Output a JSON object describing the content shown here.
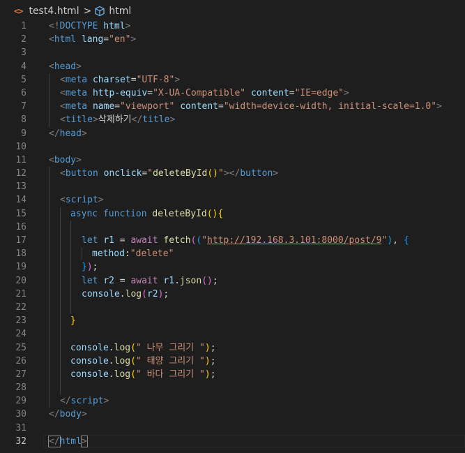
{
  "breadcrumb": {
    "file_icon": "<>",
    "file": "test4.html",
    "separator": ">",
    "symbol_icon": "cube-symbol-icon",
    "symbol": "html"
  },
  "editor": {
    "current_line": 32,
    "line_numbers": [
      "1",
      "2",
      "3",
      "4",
      "5",
      "6",
      "7",
      "8",
      "9",
      "10",
      "11",
      "12",
      "13",
      "14",
      "15",
      "16",
      "17",
      "18",
      "19",
      "20",
      "21",
      "22",
      "23",
      "24",
      "25",
      "26",
      "27",
      "28",
      "29",
      "30",
      "31",
      "32"
    ],
    "l1": [
      "<!",
      "DOCTYPE",
      " ",
      "html",
      ">"
    ],
    "l2": [
      "<",
      "html",
      " ",
      "lang",
      "=",
      "\"en\"",
      ">"
    ],
    "l4": [
      "<",
      "head",
      ">"
    ],
    "l5": [
      "<",
      "meta",
      " ",
      "charset",
      "=",
      "\"UTF-8\"",
      ">"
    ],
    "l6": [
      "<",
      "meta",
      " ",
      "http-equiv",
      "=",
      "\"X-UA-Compatible\"",
      " ",
      "content",
      "=",
      "\"IE=edge\"",
      ">"
    ],
    "l7": [
      "<",
      "meta",
      " ",
      "name",
      "=",
      "\"viewport\"",
      " ",
      "content",
      "=",
      "\"width=device-width, initial-scale=1.0\"",
      ">"
    ],
    "l8": [
      "<",
      "title",
      ">",
      "삭제하기",
      "</",
      "title",
      ">"
    ],
    "l9": [
      "</",
      "head",
      ">"
    ],
    "l11": [
      "<",
      "body",
      ">"
    ],
    "l12": [
      "<",
      "button",
      " ",
      "onclick",
      "=",
      "\"",
      "deleteById",
      "()",
      "\"",
      "></",
      "button",
      ">"
    ],
    "l14": [
      "<",
      "script",
      ">"
    ],
    "l15": [
      "async",
      " ",
      "function",
      " ",
      "deleteById",
      "()",
      "{"
    ],
    "l17": [
      "let",
      " ",
      "r1",
      " = ",
      "await",
      " ",
      "fetch",
      "(",
      "(",
      "\"",
      "http://192.168.3.101:8000/post/9",
      "\"",
      ")",
      ", ",
      "{"
    ],
    "l18": [
      "method",
      ":",
      "\"delete\""
    ],
    "l19": [
      "}",
      ")",
      ";"
    ],
    "l20": [
      "let",
      " ",
      "r2",
      " = ",
      "await",
      " ",
      "r1",
      ".",
      "json",
      "()",
      ";"
    ],
    "l21": [
      "console",
      ".",
      "log",
      "(",
      "r2",
      ")",
      ";"
    ],
    "l23": [
      "}"
    ],
    "l25": [
      "console",
      ".",
      "log",
      "(",
      "\" 나무 그리기 \"",
      ")",
      ";"
    ],
    "l26": [
      "console",
      ".",
      "log",
      "(",
      "\" 태양 그리기 \"",
      ")",
      ";"
    ],
    "l27": [
      "console",
      ".",
      "log",
      "(",
      "\" 바다 그리기 \"",
      ")",
      ";"
    ],
    "l29": [
      "</",
      "script",
      ">"
    ],
    "l30": [
      "</",
      "body",
      ">"
    ],
    "l32": [
      "</",
      "html",
      ">"
    ]
  },
  "colors": {
    "background": "#1e1e1e",
    "tag": "#569cd6",
    "attribute": "#9cdcfe",
    "string": "#ce9178",
    "function": "#dcdcaa",
    "control_keyword": "#c586c0",
    "punctuation": "#808080",
    "line_number": "#858585",
    "file_icon": "#e37933"
  }
}
